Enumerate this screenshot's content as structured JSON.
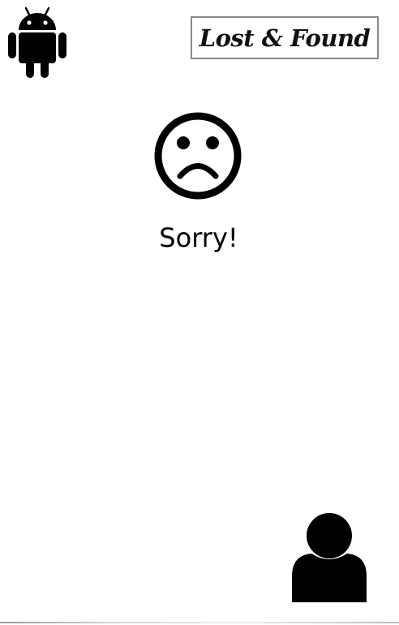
{
  "header": {
    "logo_text": "Lost & Found",
    "menu_icon": "android-icon"
  },
  "main": {
    "status_icon": "sad-face-icon",
    "message": "Sorry!"
  },
  "footer": {
    "profile_icon": "user-icon"
  },
  "colors": {
    "background": "#ffffff",
    "icon": "#000000",
    "logo_border": "#8a8a8a"
  }
}
